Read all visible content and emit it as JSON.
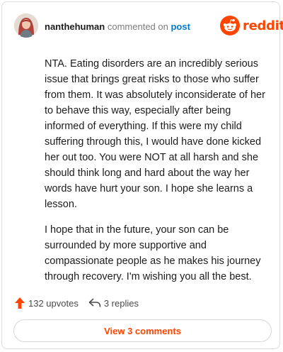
{
  "header": {
    "username": "nanthehuman",
    "action": "commented on",
    "target": "post"
  },
  "brand": {
    "name": "reddit",
    "color": "#ff4500",
    "icon": "reddit-snoo-icon"
  },
  "comment": {
    "paragraphs": [
      "NTA. Eating disorders are an incredibly serious issue that brings great risks to those who suffer from them. It was absolutely inconsiderate of her to behave this way, especially after being informed of everything. If this were my child suffering through this, I would have done kicked her out too. You were NOT at all harsh and she should think long and hard about the way her words have hurt your son. I hope she learns a lesson.",
      "I hope that in the future, your son can be surrounded by more supportive and compassionate people as he makes his journey through recovery. I'm wishing you all the best."
    ]
  },
  "footer": {
    "upvotes_label": "132 upvotes",
    "upvote_icon": "upvote-arrow-icon",
    "replies_label": "3 replies",
    "reply_icon": "reply-arrow-icon"
  },
  "view_comments_label": "View 3 comments",
  "colors": {
    "accent": "#ff4500",
    "link": "#0079d3",
    "muted": "#7c7c7c"
  }
}
